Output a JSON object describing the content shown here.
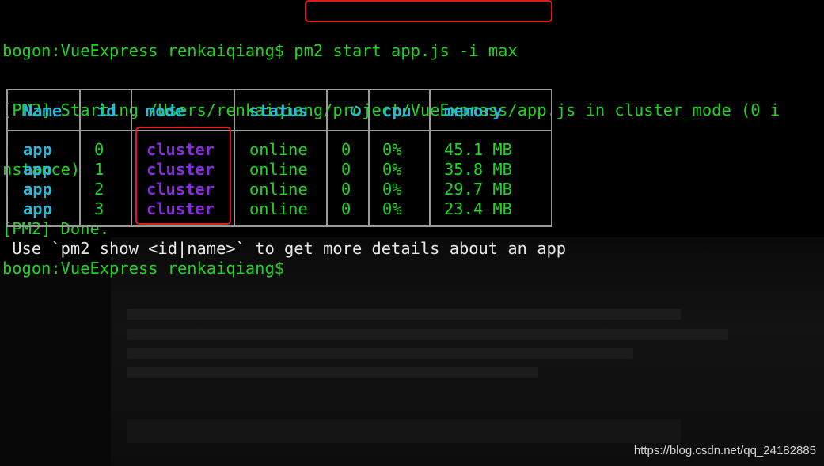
{
  "terminal": {
    "prompt": "bogon:VueExpress renkaiqiang$",
    "command": "pm2 start app.js -i max",
    "output_lines": [
      "[PM2] Starting /Users/renkaiqiang/project/VueExpress/app.js in cluster_mode (0 i",
      "nstance)",
      "[PM2] Done."
    ],
    "hint": " Use `pm2 show <id|name>` to get more details about an app",
    "final_prompt": "bogon:VueExpress renkaiqiang$"
  },
  "pm2_table": {
    "headers": {
      "name": "Name",
      "id": "id",
      "mode": "mode",
      "status": "status",
      "restart_icon": "restart-icon",
      "cpu": "cpu",
      "memory": "memory"
    },
    "rows": [
      {
        "name": "app",
        "id": "0",
        "mode": "cluster",
        "status": "online",
        "restarts": "0",
        "cpu": "0%",
        "memory": "45.1 MB"
      },
      {
        "name": "app",
        "id": "1",
        "mode": "cluster",
        "status": "online",
        "restarts": "0",
        "cpu": "0%",
        "memory": "35.8 MB"
      },
      {
        "name": "app",
        "id": "2",
        "mode": "cluster",
        "status": "online",
        "restarts": "0",
        "cpu": "0%",
        "memory": "29.7 MB"
      },
      {
        "name": "app",
        "id": "3",
        "mode": "cluster",
        "status": "online",
        "restarts": "0",
        "cpu": "0%",
        "memory": "23.4 MB"
      }
    ]
  },
  "watermark": "https://blog.csdn.net/qq_24182885",
  "colors": {
    "green": "#21d321",
    "cyan": "#2bb8d8",
    "purple": "#8a2be2",
    "highlight_red": "#e01919",
    "border_gray": "#9a9a9a",
    "white": "#e8e8e8",
    "background": "#000000"
  }
}
